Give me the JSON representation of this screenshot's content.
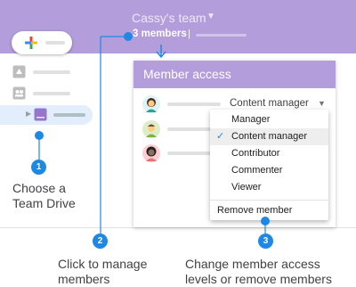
{
  "topbar": {
    "team_name": "Cassy's team",
    "members_label": "3 members",
    "members_separator": "|"
  },
  "sidebar": {
    "items": [
      {
        "icon": "drive-icon"
      },
      {
        "icon": "shared-icon"
      },
      {
        "icon": "team-drive-icon",
        "selected": true
      }
    ]
  },
  "dialog": {
    "title": "Member access",
    "members": [
      {
        "avatar": "woman-avatar-icon",
        "role": "Content manager"
      },
      {
        "avatar": "man-avatar-icon",
        "role": ""
      },
      {
        "avatar": "woman-curly-avatar-icon",
        "role": ""
      }
    ]
  },
  "role_menu": {
    "items": [
      "Manager",
      "Content manager",
      "Contributor",
      "Commenter",
      "Viewer"
    ],
    "selected": "Content manager",
    "remove_label": "Remove member"
  },
  "callouts": {
    "one": {
      "number": "1",
      "text_line1": "Choose a",
      "text_line2": "Team Drive"
    },
    "two": {
      "number": "2",
      "text_line1": "Click to manage",
      "text_line2": "members"
    },
    "three": {
      "number": "3",
      "text_line1": "Change member access",
      "text_line2": "levels or remove members"
    }
  },
  "colors": {
    "header": "#b39ddb",
    "accent": "#1e88e5",
    "selected_item": "#e3eefc"
  }
}
